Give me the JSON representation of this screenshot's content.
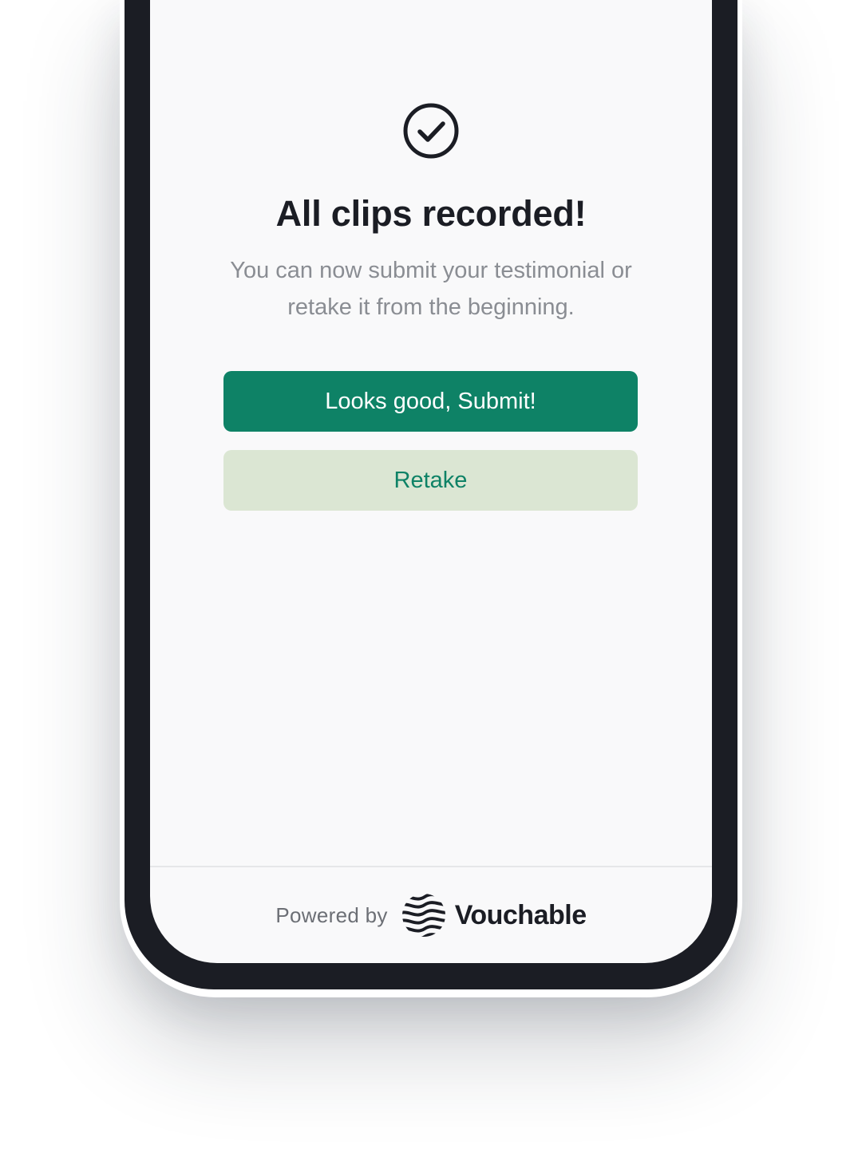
{
  "screen": {
    "icon": "check-circle-icon",
    "title": "All clips recorded!",
    "subtitle": "You can now submit your testimonial or retake it from the beginning."
  },
  "actions": {
    "submit_label": "Looks good, Submit!",
    "retake_label": "Retake"
  },
  "footer": {
    "powered_by": "Powered by",
    "brand_logo": "vouchable-wave-logo",
    "brand_name": "Vouchable"
  },
  "colors": {
    "primary": "#0e8266",
    "secondary_bg": "#dbe6d3",
    "text_dark": "#1b1d24",
    "text_muted": "#8a8d93",
    "phone_frame": "#1b1d24",
    "screen_bg": "#f9f9fa"
  }
}
